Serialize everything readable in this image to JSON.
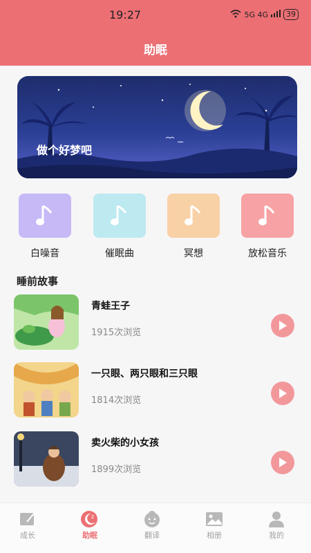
{
  "status": {
    "time": "19:27",
    "signal": "5G 4G",
    "battery": "39"
  },
  "header": {
    "title": "助眠"
  },
  "banner": {
    "text": "做个好梦吧"
  },
  "categories": [
    {
      "label": "白噪音",
      "color": "#c7b9f6"
    },
    {
      "label": "催眠曲",
      "color": "#bde9f0"
    },
    {
      "label": "冥想",
      "color": "#f8d1a6"
    },
    {
      "label": "放松音乐",
      "color": "#f7a2a4"
    }
  ],
  "section": {
    "title": "睡前故事"
  },
  "stories": [
    {
      "title": "青蛙王子",
      "views": "1915次浏览"
    },
    {
      "title": "一只眼、两只眼和三只眼",
      "views": "1814次浏览"
    },
    {
      "title": "卖火柴的小女孩",
      "views": "1899次浏览"
    }
  ],
  "tabbar": {
    "tabs": [
      {
        "label": "成长",
        "icon": "pencil-icon"
      },
      {
        "label": "助眠",
        "icon": "moon-icon"
      },
      {
        "label": "翻译",
        "icon": "kid-face-icon"
      },
      {
        "label": "相册",
        "icon": "photo-icon"
      },
      {
        "label": "我的",
        "icon": "person-icon"
      }
    ],
    "active": "助眠"
  },
  "colors": {
    "accent": "#ec6f74",
    "play": "#f2989b"
  }
}
